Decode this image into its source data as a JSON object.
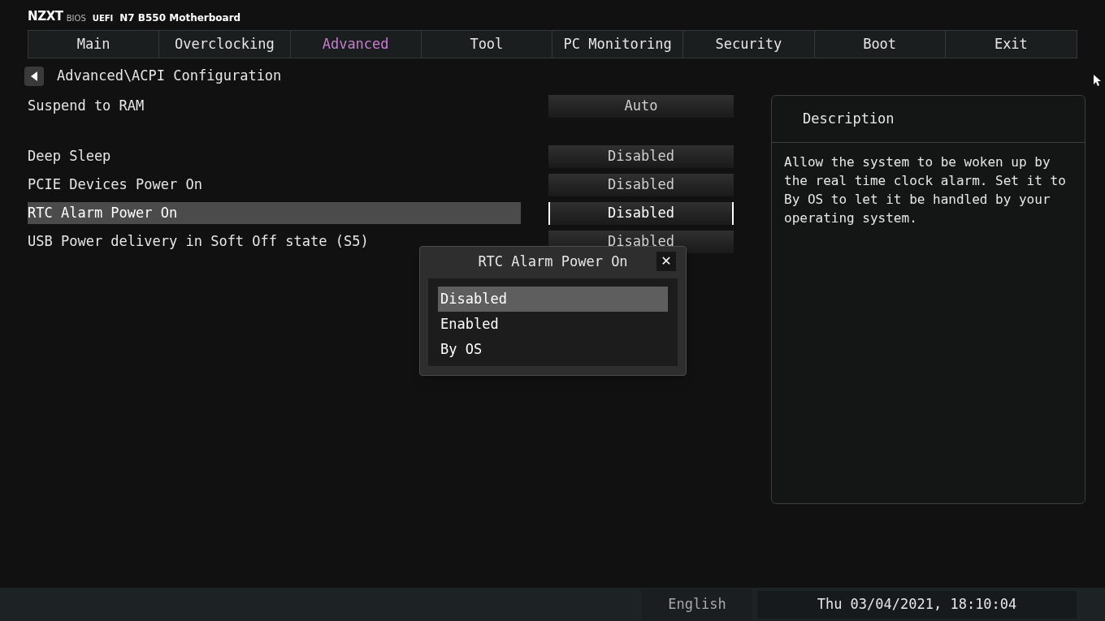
{
  "header": {
    "brand": "NZXT",
    "brand_sub": "BIOS",
    "mode": "UEFI",
    "model": "N7 B550 Motherboard"
  },
  "tabs": [
    {
      "label": "Main",
      "selected": false
    },
    {
      "label": "Overclocking",
      "selected": false
    },
    {
      "label": "Advanced",
      "selected": true
    },
    {
      "label": "Tool",
      "selected": false
    },
    {
      "label": "PC Monitoring",
      "selected": false
    },
    {
      "label": "Security",
      "selected": false
    },
    {
      "label": "Boot",
      "selected": false
    },
    {
      "label": "Exit",
      "selected": false
    }
  ],
  "breadcrumb": "Advanced\\ACPI Configuration",
  "settings": [
    {
      "label": "Suspend to RAM",
      "value": "Auto",
      "selected": false
    },
    {
      "label": "Deep Sleep",
      "value": "Disabled",
      "selected": false
    },
    {
      "label": "PCIE Devices Power On",
      "value": "Disabled",
      "selected": false
    },
    {
      "label": "RTC Alarm Power On",
      "value": "Disabled",
      "selected": true
    },
    {
      "label": "USB Power delivery in Soft Off state (S5)",
      "value": "Disabled",
      "selected": false
    }
  ],
  "description": {
    "title": "Description",
    "text": "Allow the system to be woken up by the real time clock alarm. Set it to By OS to let it be handled by your operating system."
  },
  "popup": {
    "title": "RTC Alarm Power On",
    "close": "✕",
    "options": [
      {
        "label": "Disabled",
        "selected": true
      },
      {
        "label": "Enabled",
        "selected": false
      },
      {
        "label": "By OS",
        "selected": false
      }
    ]
  },
  "status_bar": {
    "language": "English",
    "datetime": "Thu 03/04/2021, 18:10:04"
  }
}
